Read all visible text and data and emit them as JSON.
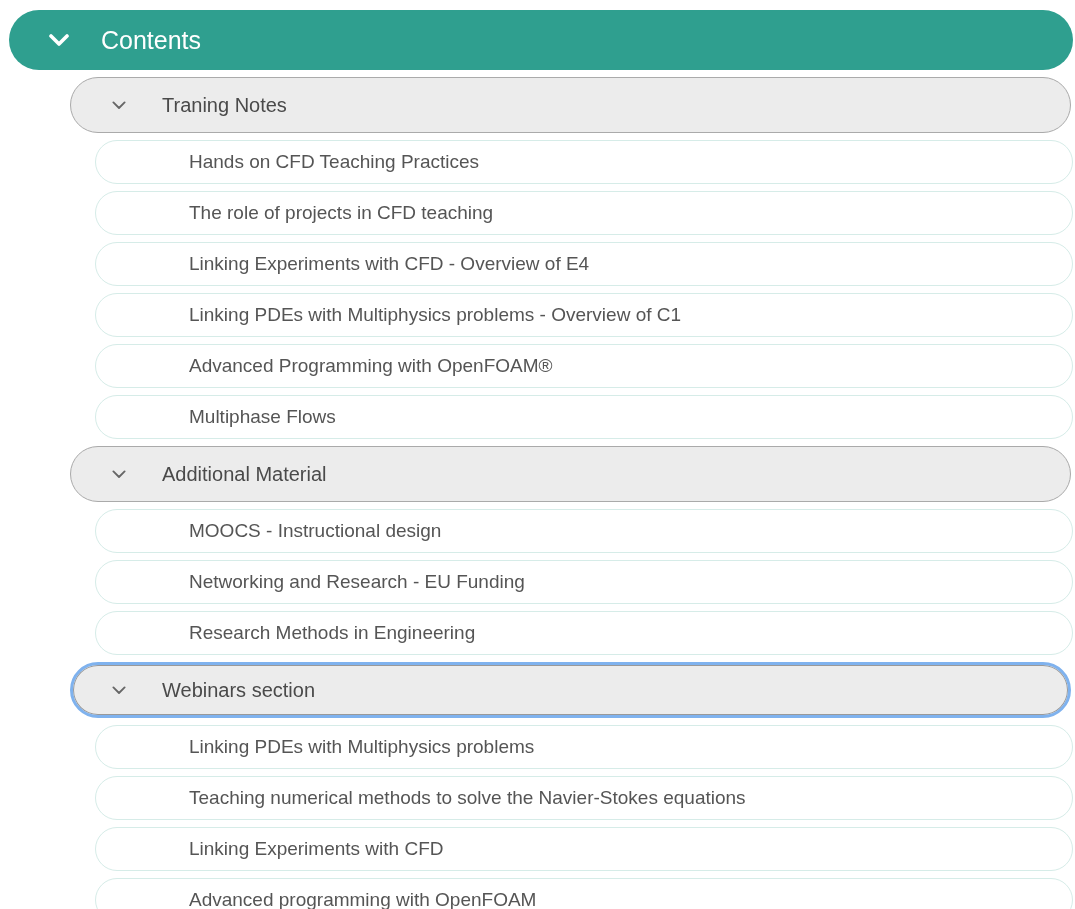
{
  "contents": {
    "title": "Contents",
    "expanded": true,
    "sections": [
      {
        "title": "Traning Notes",
        "expanded": true,
        "focused": false,
        "items": [
          "Hands on CFD Teaching Practices",
          "The role of projects in CFD teaching",
          "Linking Experiments with CFD - Overview of E4",
          "Linking PDEs with Multiphysics problems - Overview of C1",
          "Advanced Programming with OpenFOAM®",
          "Multiphase Flows"
        ]
      },
      {
        "title": "Additional Material",
        "expanded": true,
        "focused": false,
        "items": [
          "MOOCS - Instructional design",
          "Networking and Research - EU Funding",
          "Research Methods in Engineering"
        ]
      },
      {
        "title": "Webinars section",
        "expanded": true,
        "focused": true,
        "items": [
          "Linking PDEs with Multiphysics problems",
          "Teaching numerical methods to solve the Navier-Stokes equations",
          "Linking Experiments with CFD",
          "Advanced programming with OpenFOAM"
        ]
      }
    ]
  }
}
